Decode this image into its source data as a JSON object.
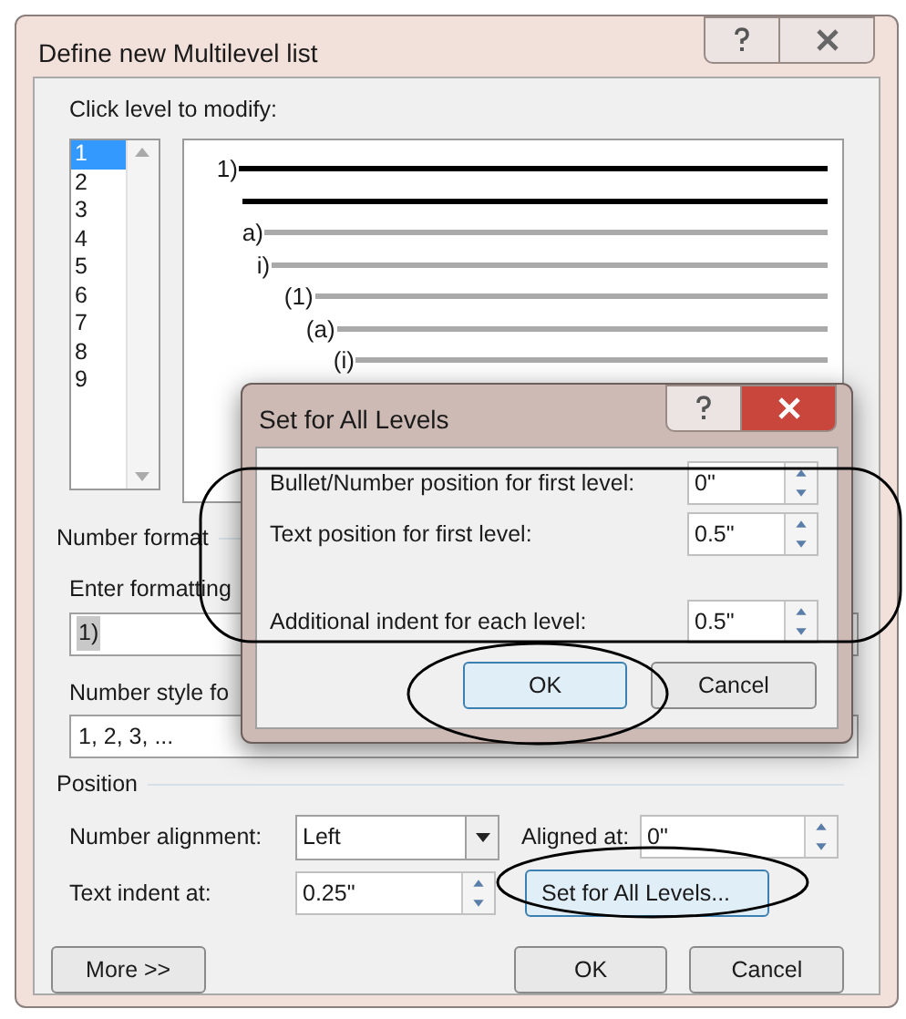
{
  "window": {
    "title": "Define new Multilevel list"
  },
  "level_prompt": "Click level to modify:",
  "levels": [
    {
      "label": "1",
      "selected": true
    },
    {
      "label": "2",
      "selected": false
    },
    {
      "label": "3",
      "selected": false
    },
    {
      "label": "4",
      "selected": false
    },
    {
      "label": "5",
      "selected": false
    },
    {
      "label": "6",
      "selected": false
    },
    {
      "label": "7",
      "selected": false
    },
    {
      "label": "8",
      "selected": false
    },
    {
      "label": "9",
      "selected": false
    }
  ],
  "preview_lines": [
    {
      "label": "1)",
      "kind": "current"
    },
    {
      "kind": "current"
    },
    {
      "label": "a)",
      "kind": "other"
    },
    {
      "label": "i)",
      "kind": "other"
    },
    {
      "label": "(1)",
      "kind": "other"
    },
    {
      "label": "(a)",
      "kind": "other"
    },
    {
      "label": "(i)",
      "kind": "other"
    }
  ],
  "number_format": {
    "heading": "Number format",
    "format_label": "Enter formatting",
    "format_value": "1)",
    "style_label": "Number style fo",
    "style_value": "1, 2, 3, ..."
  },
  "position": {
    "heading": "Position",
    "alignment_label": "Number alignment:",
    "alignment_value": "Left",
    "aligned_at_label": "Aligned at:",
    "aligned_at_value": "0\"",
    "indent_label": "Text indent at:",
    "indent_value": "0.25\"",
    "set_all_button": "Set for All Levels..."
  },
  "buttons": {
    "more": "More >>",
    "ok": "OK",
    "cancel": "Cancel"
  },
  "sub_dialog": {
    "title": "Set for All Levels",
    "fields": [
      {
        "label": "Bullet/Number position for first level:",
        "value": "0\""
      },
      {
        "label": "Text position for first level:",
        "value": "0.5\""
      },
      {
        "label": "Additional indent for each level:",
        "value": "0.5\""
      }
    ],
    "ok": "OK",
    "cancel": "Cancel"
  }
}
